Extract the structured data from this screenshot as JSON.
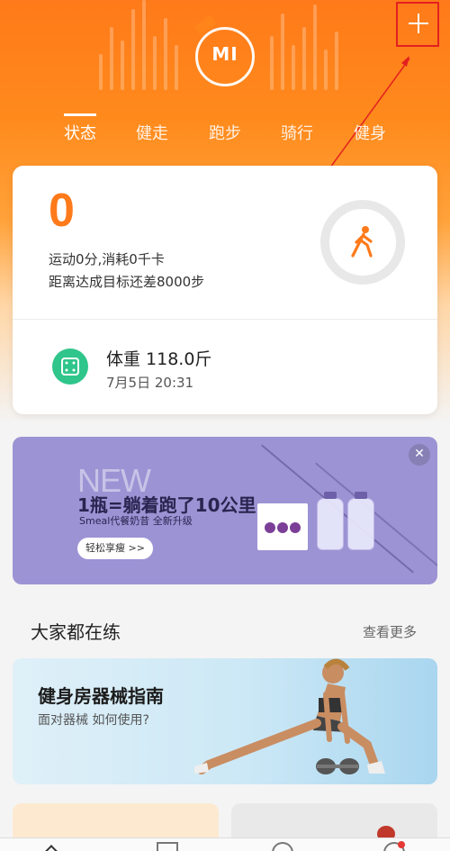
{
  "header": {
    "logo_text": "MI",
    "tabs": [
      {
        "label": "状态",
        "active": true
      },
      {
        "label": "健走",
        "active": false
      },
      {
        "label": "跑步",
        "active": false
      },
      {
        "label": "骑行",
        "active": false
      },
      {
        "label": "健身",
        "active": false
      }
    ],
    "add_icon": "plus-icon"
  },
  "status_card": {
    "steps": "0",
    "activity_text": "运动0分,消耗0千卡",
    "goal_text": "距离达成目标还差8000步",
    "walk_icon": "walking-person-icon",
    "weight_icon": "scale-icon",
    "weight_label": "体重  118.0斤",
    "weight_date": "7月5日  20:31"
  },
  "banner": {
    "new_text": "NEW",
    "title": "1瓶=躺着跑了10公里",
    "subtitle": "Smeal代餐奶昔 全新升级",
    "button_label": "轻松享瘦 >>",
    "close_icon": "close-icon",
    "close_glyph": "✕"
  },
  "section": {
    "title": "大家都在练",
    "more_label": "查看更多"
  },
  "guide_card": {
    "title": "健身房器械指南",
    "subtitle": "面对器械 如何使用?"
  },
  "colors": {
    "accent": "#ff7a1a",
    "highlight_box": "#e32020",
    "weight_green": "#2fc58b",
    "banner_bg": "#9c93d4"
  }
}
